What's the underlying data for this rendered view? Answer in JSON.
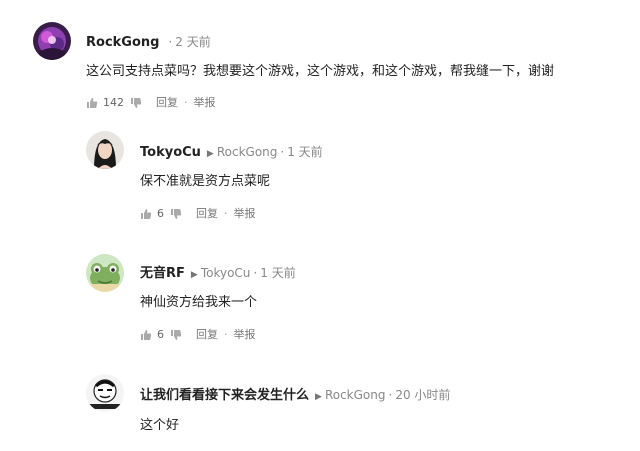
{
  "comments": [
    {
      "author": "RockGong",
      "time": "2 天前",
      "text": "这公司支持点菜吗？我想要这个游戏，这个游戏，和这个游戏，帮我缝一下，谢谢",
      "likes": "142",
      "reply": "回复",
      "report": "举报",
      "avatar_icon": "purple-character-avatar"
    },
    {
      "author": "TokyoCu",
      "reply_to": "RockGong",
      "time": "1 天前",
      "text": "保不准就是资方点菜呢",
      "likes": "6",
      "reply": "回复",
      "report": "举报",
      "avatar_icon": "woman-portrait-avatar"
    },
    {
      "author": "无音RF",
      "reply_to": "TokyoCu",
      "time": "1 天前",
      "text": "神仙资方给我来一个",
      "likes": "6",
      "reply": "回复",
      "report": "举报",
      "avatar_icon": "frog-avatar"
    },
    {
      "author": "让我们看看接下来会发生什么",
      "reply_to": "RockGong",
      "time": "20 小时前",
      "text": "这个好",
      "avatar_icon": "meme-face-avatar"
    }
  ]
}
